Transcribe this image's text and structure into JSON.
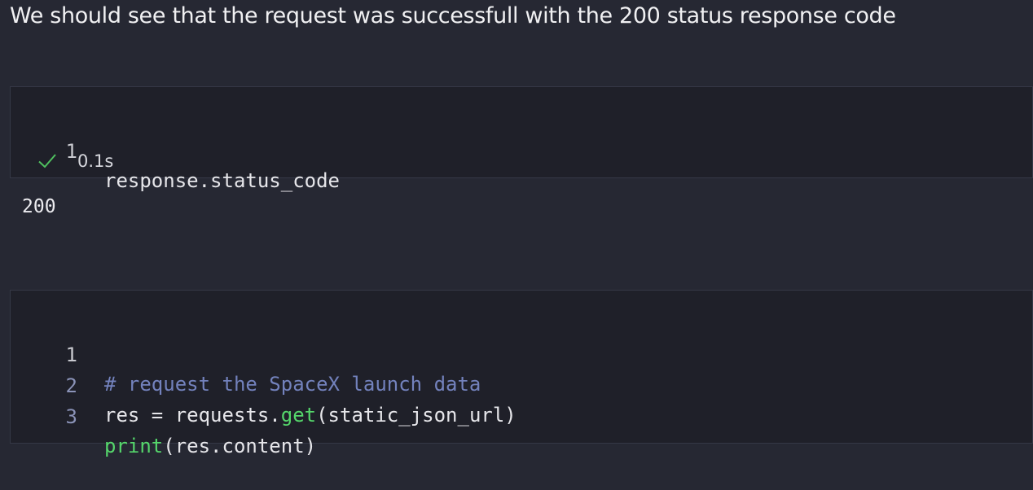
{
  "markdown": {
    "text": "We should see that the request was successfull with the 200 status response code"
  },
  "cell1": {
    "lines": [
      {
        "number": "1",
        "code": "response.status_code"
      }
    ],
    "execution": {
      "status_icon": "checkmark-icon",
      "time": "0.1s"
    },
    "output": "200"
  },
  "cell2": {
    "lines": [
      {
        "number": "1",
        "comment": "# request the SpaceX launch data"
      },
      {
        "number": "2",
        "var": "res ",
        "op": "=",
        "obj": " requests.",
        "func": "get",
        "args": "(static_json_url)"
      },
      {
        "number": "3",
        "func": "print",
        "args": "(res.content)"
      }
    ]
  },
  "colors": {
    "background": "#262833",
    "cell_background": "#1f2029",
    "comment": "#7382bd",
    "function": "#55d66b",
    "success_check": "#4fc15f"
  }
}
